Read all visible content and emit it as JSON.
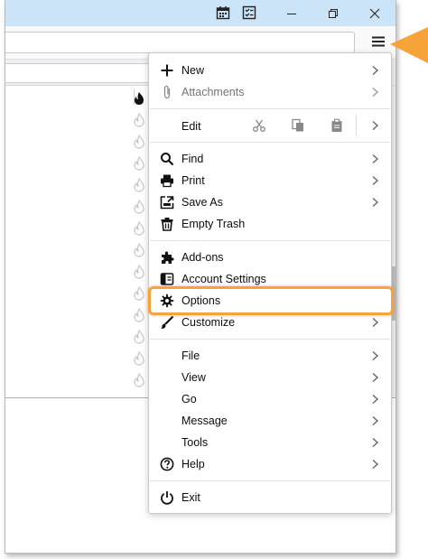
{
  "menu": {
    "items": {
      "new": "New",
      "attachments": "Attachments",
      "edit": "Edit",
      "find": "Find",
      "print": "Print",
      "save_as": "Save As",
      "empty_trash": "Empty Trash",
      "addons": "Add-ons",
      "account_settings": "Account Settings",
      "options": "Options",
      "customize": "Customize",
      "file": "File",
      "view": "View",
      "go": "Go",
      "message": "Message",
      "tools": "Tools",
      "help": "Help",
      "exit": "Exit"
    }
  },
  "icons": {
    "titlebar": [
      "calendar-icon",
      "tasks-icon"
    ],
    "window_controls": [
      "minimize-icon",
      "restore-icon",
      "close-icon"
    ],
    "toolbar": [
      "hamburger-menu-icon"
    ],
    "edit_actions": [
      "cut-icon",
      "copy-icon",
      "paste-icon"
    ],
    "menu": [
      "plus-icon",
      "paperclip-icon",
      "search-icon",
      "printer-icon",
      "save-icon",
      "trash-icon",
      "puzzle-icon",
      "account-settings-icon",
      "gear-icon",
      "brush-icon",
      "help-icon",
      "power-icon",
      "chevron-right-icon"
    ],
    "list": "flame-icon",
    "annotation": "callout-arrow-icon"
  },
  "colors": {
    "titlebar": "#cce4f7",
    "highlight": "#f6a33a",
    "callout": "#f6a33a"
  }
}
